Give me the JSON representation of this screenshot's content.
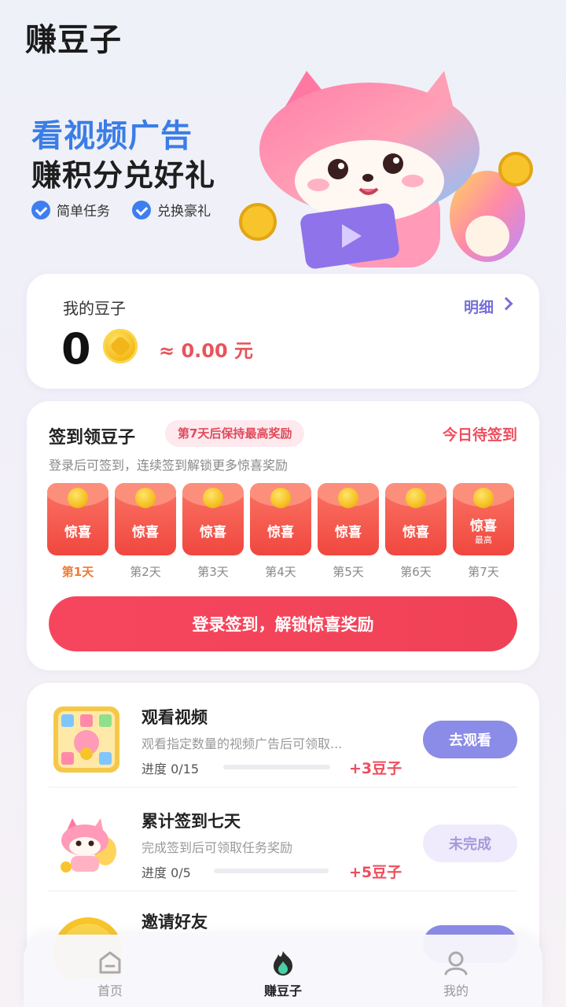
{
  "app": {
    "title": "赚豆子"
  },
  "hero": {
    "line1": "看视频广告",
    "line2": "赚积分兑好礼",
    "tags": [
      "简单任务",
      "兑换豪礼"
    ]
  },
  "balance": {
    "label": "我的豆子",
    "detail": "明细",
    "value": "0",
    "yuan": "≈ 0.00 元"
  },
  "signin": {
    "title": "签到领豆子",
    "badge": "第7天后保持最高奖励",
    "status": "今日待签到",
    "subtitle": "登录后可签到，连续签到解锁更多惊喜奖励",
    "days": [
      {
        "reward": "惊喜",
        "label": "第1天",
        "active": true
      },
      {
        "reward": "惊喜",
        "label": "第2天"
      },
      {
        "reward": "惊喜",
        "label": "第3天"
      },
      {
        "reward": "惊喜",
        "label": "第4天"
      },
      {
        "reward": "惊喜",
        "label": "第5天"
      },
      {
        "reward": "惊喜",
        "label": "第6天"
      },
      {
        "reward": "惊喜",
        "sub": "最高",
        "label": "第7天"
      }
    ],
    "button": "登录签到，解锁惊喜奖励"
  },
  "tasks": [
    {
      "name": "观看视频",
      "desc": "观看指定数量的视频广告后可领取...",
      "progress": "进度 0/15",
      "progress_value": 0,
      "reward": "+3豆子",
      "button": "去观看",
      "state": "go"
    },
    {
      "name": "累计签到七天",
      "desc": "完成签到后可领取任务奖励",
      "progress": "进度 0/5",
      "progress_value": 0,
      "reward": "+5豆子",
      "button": "未完成",
      "state": "done"
    },
    {
      "name": "邀请好友",
      "button": "",
      "state": "go"
    }
  ],
  "nav": {
    "items": [
      "首页",
      "赚豆子",
      "我的"
    ],
    "active": 1
  },
  "colors": {
    "accent": "#f04256",
    "brand_blue": "#3a7de6",
    "purple": "#8b8be8"
  }
}
